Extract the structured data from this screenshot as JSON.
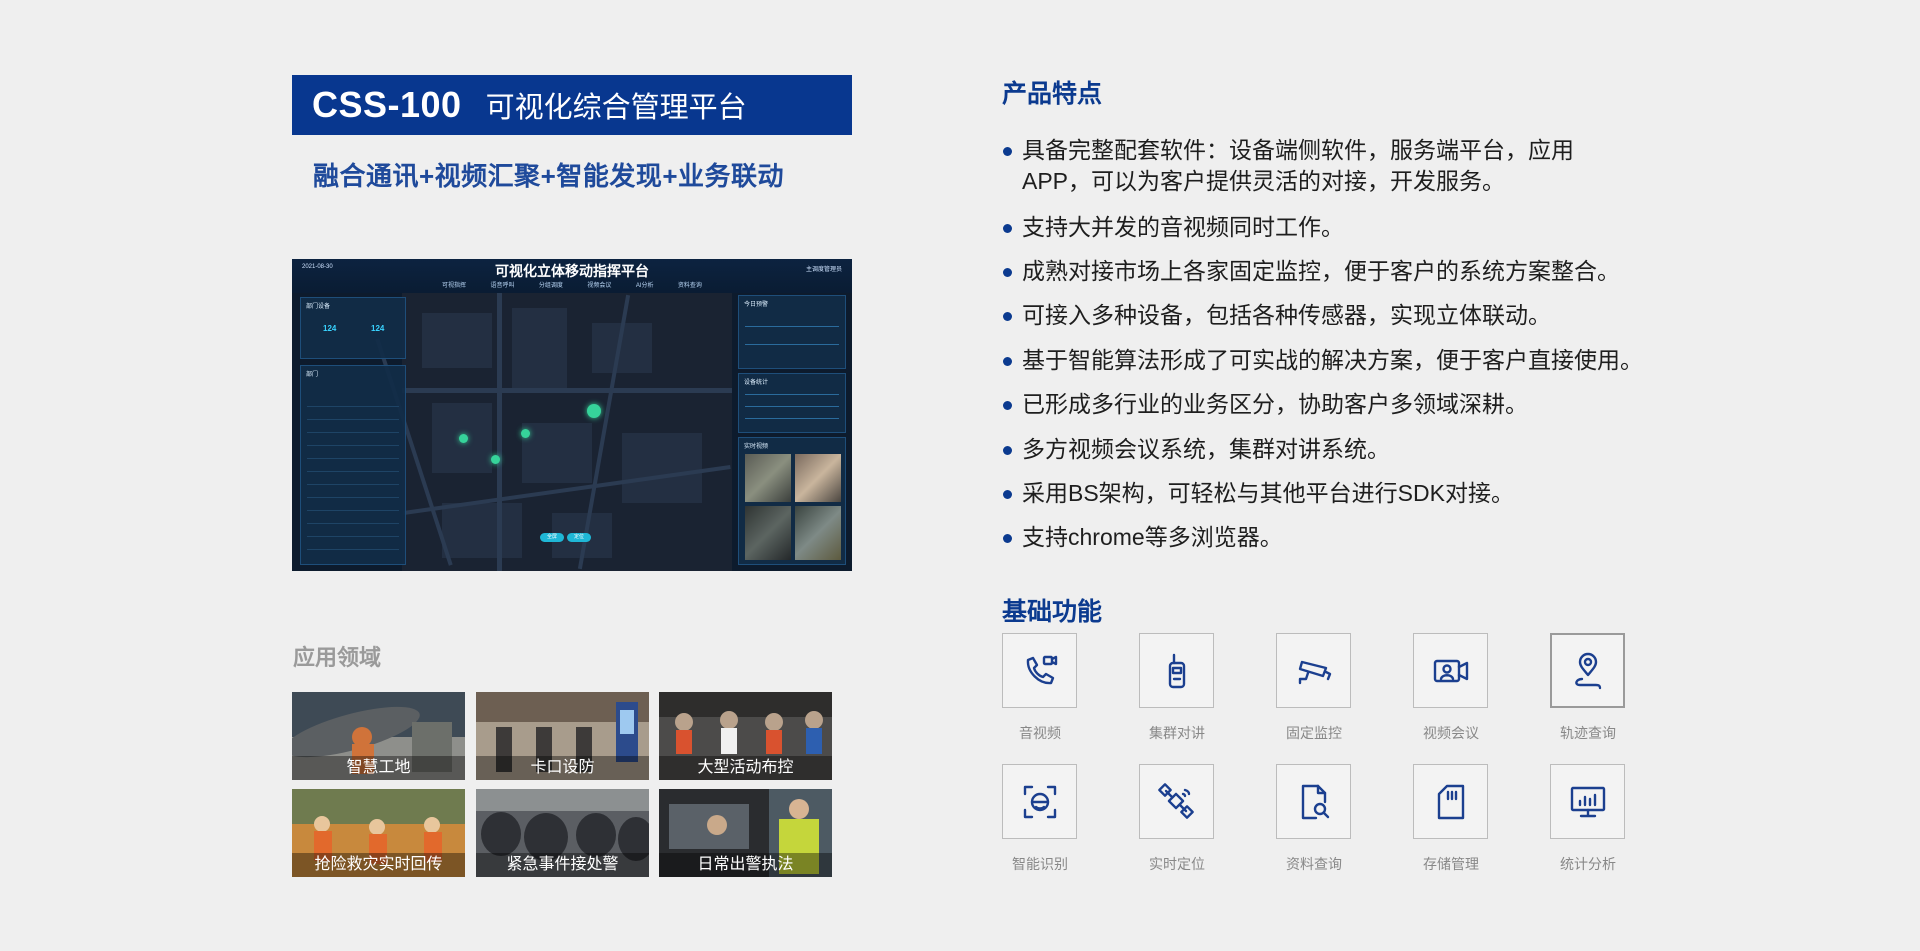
{
  "header": {
    "model": "CSS-100",
    "product_name": "可视化综合管理平台",
    "subtitle": "融合通讯+视频汇聚+智能发现+业务联动"
  },
  "dashboard": {
    "title": "可视化立体移动指挥平台",
    "date": "2021-08-30",
    "user": "主调度管理员",
    "menu": [
      "可视指挥",
      "语音呼叫",
      "分组调度",
      "视频会议",
      "AI分析",
      "资料查询"
    ],
    "panel_left_title": "部门设备",
    "stat_a": "124",
    "stat_b": "124",
    "list_title": "部门",
    "right_panel_title": "今日预警",
    "video_title": "实时视频",
    "device_stat_title": "设备统计"
  },
  "applications": {
    "heading": "应用领域",
    "items": [
      {
        "label": "智慧工地",
        "colors": [
          "#3e4a55",
          "#8e8f8b",
          "#d0733a"
        ]
      },
      {
        "label": "卡口设防",
        "colors": [
          "#6d5f52",
          "#a89c8c",
          "#3d3a39"
        ]
      },
      {
        "label": "大型活动布控",
        "colors": [
          "#4c4b4a",
          "#b9a28c",
          "#d9522f"
        ]
      },
      {
        "label": "抢险救灾实时回传",
        "colors": [
          "#6f7b4f",
          "#c8893d",
          "#e2692c"
        ]
      },
      {
        "label": "紧急事件接处警",
        "colors": [
          "#2e3035",
          "#5b5e63",
          "#8c9091"
        ]
      },
      {
        "label": "日常出警执法",
        "colors": [
          "#2a2c2f",
          "#4d5a63",
          "#c5d63b"
        ]
      }
    ]
  },
  "features": {
    "heading": "产品特点",
    "items": [
      "具备完整配套软件：设备端侧软件，服务端平台，应用",
      "APP，可以为客户提供灵活的对接，开发服务。",
      "支持大并发的音视频同时工作。",
      "成熟对接市场上各家固定监控，便于客户的系统方案整合。",
      "可接入多种设备，包括各种传感器，实现立体联动。",
      "基于智能算法形成了可实战的解决方案，便于客户直接使用。",
      "已形成多行业的业务区分，协助客户多领域深耕。",
      "多方视频会议系统，集群对讲系统。",
      "采用BS架构，可轻松与其他平台进行SDK对接。",
      "支持chrome等多浏览器。"
    ]
  },
  "functions": {
    "heading": "基础功能",
    "accent": "#1b3f8f",
    "items": [
      {
        "label": "音视频",
        "icon": "phone-video-icon"
      },
      {
        "label": "集群对讲",
        "icon": "walkie-talkie-icon"
      },
      {
        "label": "固定监控",
        "icon": "cctv-camera-icon"
      },
      {
        "label": "视频会议",
        "icon": "video-conference-icon"
      },
      {
        "label": "轨迹查询",
        "icon": "route-pin-icon"
      },
      {
        "label": "智能识别",
        "icon": "face-recognition-icon"
      },
      {
        "label": "实时定位",
        "icon": "satellite-icon"
      },
      {
        "label": "资料查询",
        "icon": "document-search-icon"
      },
      {
        "label": "存储管理",
        "icon": "sd-card-icon"
      },
      {
        "label": "统计分析",
        "icon": "monitor-chart-icon"
      }
    ]
  }
}
